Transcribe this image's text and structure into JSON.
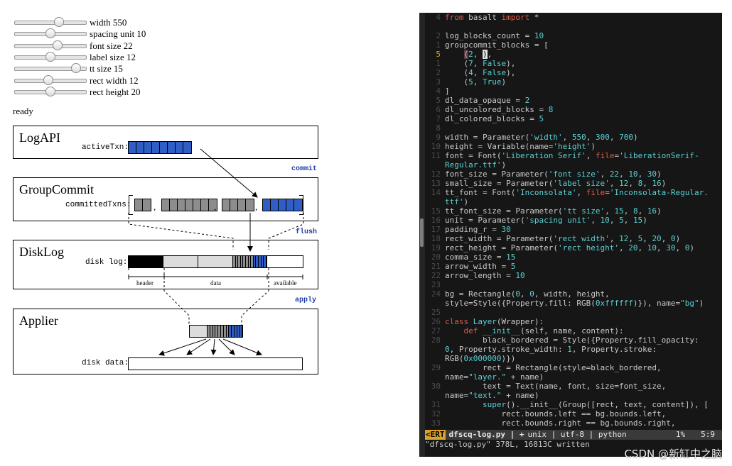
{
  "sliders": [
    {
      "label": "width 550",
      "fraction": 0.62
    },
    {
      "label": "spacing unit 10",
      "fraction": 0.5
    },
    {
      "label": "font size 22",
      "fraction": 0.6
    },
    {
      "label": "label size 12",
      "fraction": 0.5
    },
    {
      "label": "tt size 15",
      "fraction": 0.86
    },
    {
      "label": "rect width 12",
      "fraction": 0.47
    },
    {
      "label": "rect height 20",
      "fraction": 0.5
    }
  ],
  "status": "ready",
  "diagram": {
    "layers": [
      {
        "title": "LogAPI",
        "content_label": "activeTxn:"
      },
      {
        "title": "GroupCommit",
        "content_label": "committedTxns:"
      },
      {
        "title": "DiskLog",
        "content_label": "disk log:"
      },
      {
        "title": "Applier",
        "content_label": "disk data:"
      }
    ],
    "edges": [
      "commit",
      "flush",
      "apply"
    ],
    "separator": ",",
    "disk_segments": [
      "header",
      "data",
      "available"
    ],
    "colors": {
      "blue": "#2f5fc4",
      "gray": "#8d8d8d",
      "light_gray": "#dcdcdc"
    }
  },
  "editor": {
    "lines": [
      {
        "num": "4",
        "html": "<span class='k'>from</span> basalt <span class='k'>import</span> *"
      },
      {
        "num": "",
        "html": ""
      },
      {
        "num": "2",
        "html": "log_blocks_count = <span class='n'>10</span>"
      },
      {
        "num": "1",
        "html": "groupcommit_blocks = ["
      },
      {
        "num": "5",
        "cur": true,
        "html": "    <span class='cur-hl'>(</span><span class='n'>2</span>, <span class='cur-block'>)</span>,"
      },
      {
        "num": "1",
        "html": "    (<span class='n'>7</span>, <span class='s'>False</span>),"
      },
      {
        "num": "2",
        "html": "    (<span class='n'>4</span>, <span class='s'>False</span>),"
      },
      {
        "num": "3",
        "html": "    (<span class='n'>5</span>, <span class='s'>True</span>)"
      },
      {
        "num": "4",
        "html": "]"
      },
      {
        "num": "5",
        "html": "dl_data_opaque = <span class='n'>2</span>"
      },
      {
        "num": "6",
        "html": "dl_uncolored_blocks = <span class='n'>8</span>"
      },
      {
        "num": "7",
        "html": "dl_colored_blocks = <span class='n'>5</span>"
      },
      {
        "num": "8",
        "html": ""
      },
      {
        "num": "9",
        "html": "width = Parameter(<span class='s'>'width'</span>, <span class='n'>550</span>, <span class='n'>300</span>, <span class='n'>700</span>)"
      },
      {
        "num": "10",
        "html": "height = Variable(name=<span class='s'>'height'</span>)"
      },
      {
        "num": "11",
        "html": "font = Font(<span class='s'>'Liberation Serif'</span>, <span class='k'>file</span>=<span class='s'>'LiberationSerif-</span>"
      },
      {
        "num": "",
        "html": "<span class='s'>Regular.ttf'</span>)"
      },
      {
        "num": "12",
        "html": "font_size = Parameter(<span class='s'>'font size'</span>, <span class='n'>22</span>, <span class='n'>10</span>, <span class='n'>30</span>)"
      },
      {
        "num": "13",
        "html": "small_size = Parameter(<span class='s'>'label size'</span>, <span class='n'>12</span>, <span class='n'>8</span>, <span class='n'>16</span>)"
      },
      {
        "num": "14",
        "html": "tt_font = Font(<span class='s'>'Inconsolata'</span>, <span class='k'>file</span>=<span class='s'>'Inconsolata-Regular.</span>"
      },
      {
        "num": "",
        "html": "<span class='s'>ttf'</span>)"
      },
      {
        "num": "15",
        "html": "tt_font_size = Parameter(<span class='s'>'tt size'</span>, <span class='n'>15</span>, <span class='n'>8</span>, <span class='n'>16</span>)"
      },
      {
        "num": "16",
        "html": "unit = Parameter(<span class='s'>'spacing unit'</span>, <span class='n'>10</span>, <span class='n'>5</span>, <span class='n'>15</span>)"
      },
      {
        "num": "17",
        "html": "padding_r = <span class='n'>30</span>"
      },
      {
        "num": "18",
        "html": "rect_width = Parameter(<span class='s'>'rect width'</span>, <span class='n'>12</span>, <span class='n'>5</span>, <span class='n'>20</span>, <span class='n'>0</span>)"
      },
      {
        "num": "19",
        "html": "rect_height = Parameter(<span class='s'>'rect height'</span>, <span class='n'>20</span>, <span class='n'>10</span>, <span class='n'>30</span>, <span class='n'>0</span>)"
      },
      {
        "num": "20",
        "html": "comma_size = <span class='n'>15</span>"
      },
      {
        "num": "21",
        "html": "arrow_width = <span class='n'>5</span>"
      },
      {
        "num": "22",
        "html": "arrow_length = <span class='n'>10</span>"
      },
      {
        "num": "23",
        "html": ""
      },
      {
        "num": "24",
        "html": "bg = Rectangle(<span class='n'>0</span>, <span class='n'>0</span>, width, height,"
      },
      {
        "num": "",
        "html": "style=Style({Property.fill: RGB(<span class='n'>0xffffff</span>)}), name=<span class='s'>\"bg\"</span>)"
      },
      {
        "num": "25",
        "html": ""
      },
      {
        "num": "26",
        "html": "<span class='k'>class</span> <span class='s'>Layer</span>(Wrapper):"
      },
      {
        "num": "27",
        "html": "    <span class='k'>def</span> <span class='s'>__init__</span>(self, name, content):"
      },
      {
        "num": "28",
        "html": "        black_bordered = Style({Property.fill_opacity:"
      },
      {
        "num": "",
        "html": "<span class='n'>0</span>, Property.stroke_width: <span class='n'>1</span>, Property.stroke:"
      },
      {
        "num": "",
        "html": "RGB(<span class='n'>0x000000</span>)})"
      },
      {
        "num": "29",
        "html": "        rect = Rectangle(style=black_bordered,"
      },
      {
        "num": "",
        "html": "name=<span class='s'>\"layer.\"</span> + name)"
      },
      {
        "num": "30",
        "html": "        text = Text(name, font, size=font_size,"
      },
      {
        "num": "",
        "html": "name=<span class='s'>\"text.\"</span> + name)"
      },
      {
        "num": "31",
        "html": "        <span class='s'>super</span>().__init__(Group([rect, text, content]), ["
      },
      {
        "num": "32",
        "html": "            rect.bounds.left == bg.bounds.left,"
      },
      {
        "num": "33",
        "html": "            rect.bounds.right == bg.bounds.right,"
      }
    ],
    "statusline": {
      "mode": "<ERT",
      "filename": "dfscq-log.py | +",
      "fileformat": "unix",
      "encoding": "utf-8",
      "filetype": "python",
      "percent": "1%",
      "position": "5:9"
    },
    "message": "\"dfscq-log.py\" 378L, 16813C written"
  },
  "watermark": "CSDN @新缸中之脑"
}
